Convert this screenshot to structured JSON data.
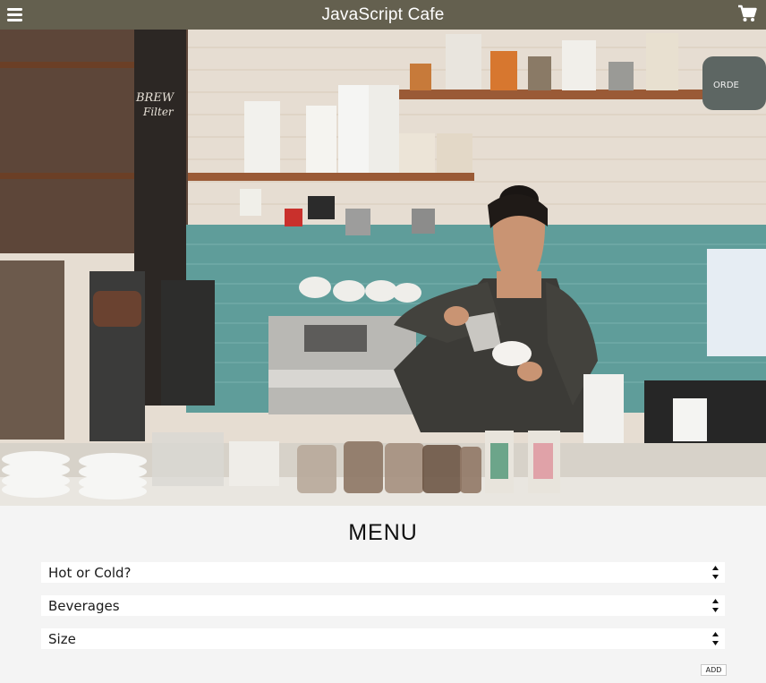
{
  "header": {
    "title": "JavaScript Cafe",
    "menu_icon": "hamburger-menu-icon",
    "cart_icon": "shopping-cart-icon",
    "background_color": "#64604f"
  },
  "hero": {
    "image_subject": "barista pouring milk into a cup at a cafe coffee bar"
  },
  "menu": {
    "heading": "MENU",
    "selects": [
      {
        "selected": "Hot or Cold?"
      },
      {
        "selected": "Beverages"
      },
      {
        "selected": "Size"
      }
    ],
    "add_label": "ADD"
  }
}
